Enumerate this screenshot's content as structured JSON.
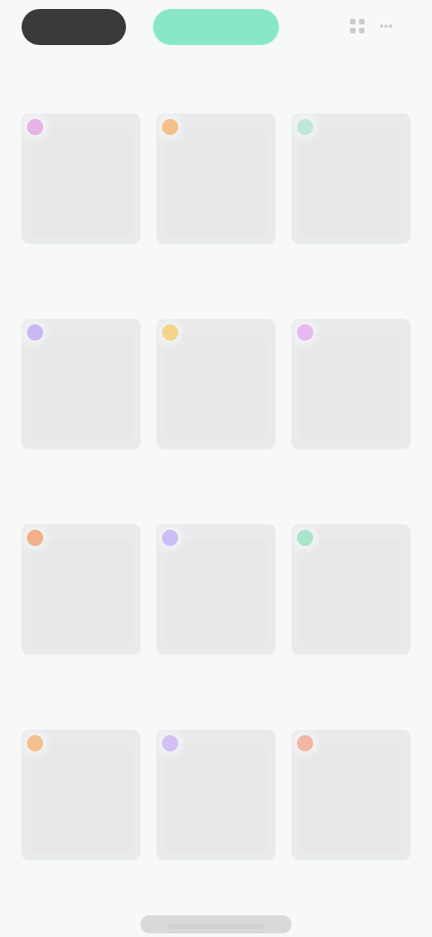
{
  "header": {
    "tab_primary_label": "",
    "tab_accent_label": "",
    "title": ""
  },
  "colors": {
    "accent": "#89e7c9",
    "dark_pill": "#3a3a3a",
    "card_background": "#e8eaeb",
    "page_background": "#f7f8f8"
  },
  "icons": [
    "grid-icon",
    "more-icon"
  ],
  "items": [
    {
      "label": "",
      "dot_color": "#e7b2e4"
    },
    {
      "label": "",
      "dot_color": "#f3c08a"
    },
    {
      "label": "",
      "dot_color": "#bfe7db"
    },
    {
      "label": "",
      "dot_color": "#cbb8f2"
    },
    {
      "label": "",
      "dot_color": "#f3d58a"
    },
    {
      "label": "",
      "dot_color": "#e6b8ef"
    },
    {
      "label": "",
      "dot_color": "#f0b08a"
    },
    {
      "label": "",
      "dot_color": "#cdbcf5"
    },
    {
      "label": "",
      "dot_color": "#a9e4cb"
    },
    {
      "label": "",
      "dot_color": "#f2c08d"
    },
    {
      "label": "",
      "dot_color": "#d2c1f2"
    },
    {
      "label": "",
      "dot_color": "#f1b7a2"
    }
  ],
  "footer": {
    "label": ""
  }
}
